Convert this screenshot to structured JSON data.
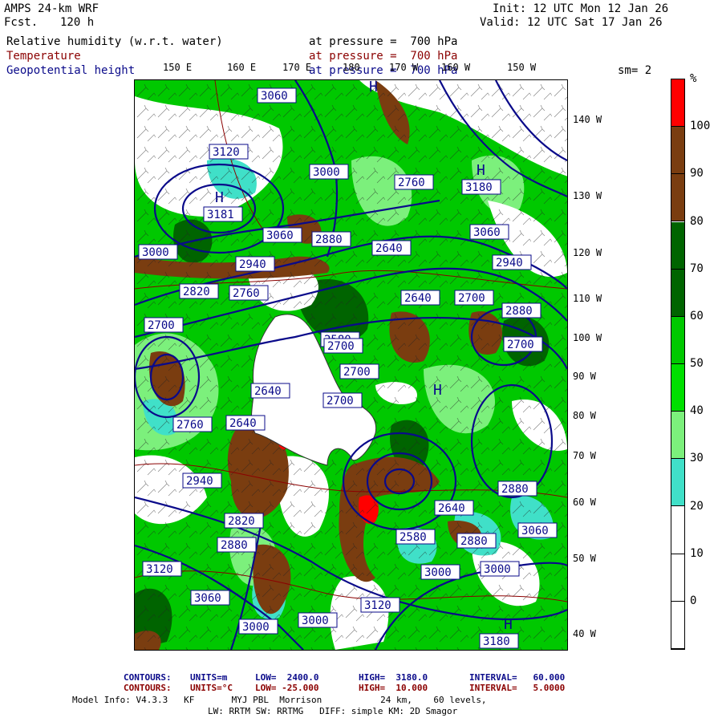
{
  "header": {
    "model": "AMPS 24-km WRF",
    "fcst_label": "Fcst.",
    "fcst_value": "120 h",
    "init": "Init: 12 UTC Mon 12 Jan 26",
    "valid": "Valid: 12 UTC Sat 17 Jan 26",
    "fields": [
      {
        "name": "Relative humidity (w.r.t. water)",
        "level": "at pressure =  700 hPa",
        "color": "#000000"
      },
      {
        "name": "Temperature",
        "level": "at pressure =  700 hPa",
        "color": "#8b0000"
      },
      {
        "name": "Geopotential height",
        "level": "at pressure =  700 hPa",
        "color": "#0a0a8a"
      }
    ],
    "smoothing": "sm= 2"
  },
  "longitude_labels_top": [
    "150 E",
    "160 E",
    "170 E",
    "180",
    "170 W",
    "160 W",
    "150 W"
  ],
  "longitude_labels_right": [
    "140 W",
    "130 W",
    "120 W",
    "110 W",
    "100 W",
    "90 W",
    "80 W",
    "70 W",
    "60 W",
    "50 W",
    "40 W"
  ],
  "height_labels": [
    "3060",
    "3000",
    "3120",
    "3181",
    "3060",
    "2880",
    "2940",
    "3000",
    "2820",
    "2760",
    "2700",
    "2640",
    "2580",
    "2640",
    "2700",
    "2700",
    "2760",
    "2640",
    "2700",
    "2640",
    "2580",
    "2700",
    "3000",
    "2820",
    "2940",
    "2880",
    "2880",
    "2880",
    "3120",
    "3060",
    "3000",
    "3000",
    "3120",
    "3060",
    "3000",
    "3180",
    "3060",
    "2940",
    "2880",
    "2700",
    "2760",
    "2640",
    "3180"
  ],
  "high_markers": [
    "H",
    "H",
    "H",
    "H",
    "H"
  ],
  "colorbar": {
    "unit": "%",
    "ticks": [
      "100",
      "90",
      "80",
      "70",
      "60",
      "50",
      "40",
      "30",
      "20",
      "10",
      "0"
    ],
    "bands": [
      {
        "color": "#ff0000"
      },
      {
        "color": "#7a3d10"
      },
      {
        "color": "#7a3d10"
      },
      {
        "color": "#006400"
      },
      {
        "color": "#006400"
      },
      {
        "color": "#00c800"
      },
      {
        "color": "#00e000"
      },
      {
        "color": "#7cf07c"
      },
      {
        "color": "#40e0c8"
      },
      {
        "color": "#ffffff"
      },
      {
        "color": "#ffffff"
      },
      {
        "color": "#ffffff"
      }
    ]
  },
  "footer": {
    "contours_m": {
      "label": "CONTOURS:",
      "units": "UNITS=m",
      "low": "LOW=  2400.0",
      "high": "HIGH=  3180.0",
      "interval": "INTERVAL=   60.000",
      "color": "#0a0a8a"
    },
    "contours_c": {
      "label": "CONTOURS:",
      "units": "UNITS=°C",
      "low": "LOW= -25.000",
      "high": "HIGH=  10.000",
      "interval": "INTERVAL=   5.0000",
      "color": "#8b0000"
    },
    "model_info_1": "Model Info: V4.3.3   KF       MYJ PBL  Morrison           24 km,    60 levels,",
    "model_info_2": "LW: RRTM SW: RRTMG   DIFF: simple KM: 2D Smagor"
  }
}
